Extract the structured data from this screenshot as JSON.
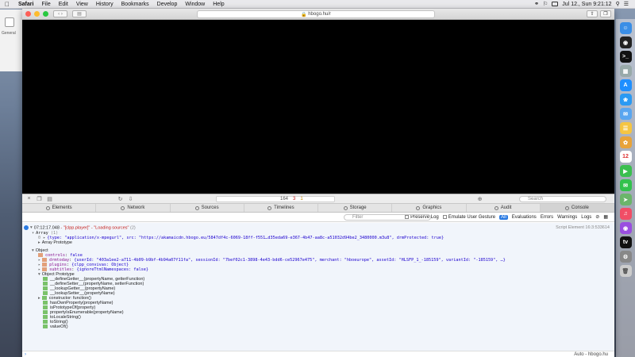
{
  "menubar": {
    "app": "Safari",
    "items": [
      "File",
      "Edit",
      "View",
      "History",
      "Bookmarks",
      "Develop",
      "Window",
      "Help"
    ],
    "clock": "Jul 12., Sun  9:21:12"
  },
  "bg_window": {
    "label": "General"
  },
  "browser": {
    "url": "hbogo.hu/r"
  },
  "inspector": {
    "activity": {
      "resources": "164",
      "errors": "3",
      "warnings": "1"
    },
    "search_placeholder": "Search",
    "tabs": [
      "Elements",
      "Network",
      "Sources",
      "Timelines",
      "Storage",
      "Graphics",
      "Audit",
      "Console"
    ],
    "console_toolbar": {
      "filter_placeholder": "Filter",
      "preserve_log": "Preserve Log",
      "emulate": "Emulate User Gesture",
      "all": "All",
      "evaluations": "Evaluations",
      "errors": "Errors",
      "warnings": "Warnings",
      "logs": "Logs"
    },
    "log": {
      "timestamp": "07:12:17.048",
      "prefix": "- \"[clpp.player]\" - \"Loading sources\"",
      "count": "(2)",
      "source": "Script Element 16:3:533614",
      "array_label": "Array",
      "array_count": "(1)",
      "array_item": "{type: \"application/x-mpegurl\", src: \"https://akamaicdn.hbogo.eu/5847df4c-6069-18ff-f551…d35eda69-e367-4b47-aa8c-a51032d94be2_3480000.m3u8\", drmProtected: true}",
      "array_proto": "Array Prototype",
      "object_label": "Object",
      "props": [
        {
          "name": "controls",
          "value": "false"
        },
        {
          "name": "drmtoday",
          "value": "{userId: \"403a1ee2-a711-4b09-b9bf-4b94a07f11fa\", sessionId: \"7bef02c1-3898-4e43-bdd6-ce52967e475\", merchant: \"hboeurope\", assetId: \"HLSFP_1_-185159\", variantId: \"-185159\", …}"
        },
        {
          "name": "plugins",
          "value": "{clpp_convivas: Object}"
        },
        {
          "name": "subtitles",
          "value": "{ignoreTtmlNamespaces: false}"
        }
      ],
      "object_proto": "Object Prototype",
      "methods": [
        "__defineGetter__(propertyName, getterFunction)",
        "__defineSetter__(propertyName, setterFunction)",
        "__lookupGetter__(propertyName)",
        "__lookupSetter__(propertyName)",
        "constructor: function()",
        "hasOwnProperty(propertyName)",
        "isPrototypeOf(property)",
        "propertyIsEnumerable(propertyName)",
        "toLocaleString()",
        "toString()",
        "valueOf()"
      ]
    },
    "context": "Auto - hbogo.hu"
  },
  "colors": {
    "close": "#fc5f57",
    "min": "#fdbc2e",
    "max": "#28c840",
    "accent": "#2a7ae2"
  },
  "dock_icons": [
    "finder-icon",
    "siri-icon",
    "terminal-icon",
    "launchpad-icon",
    "appstore-icon",
    "safari-icon",
    "mail-icon",
    "notes-icon",
    "photos-icon",
    "calendar-icon",
    "facetime-icon",
    "messages-icon",
    "maps-icon",
    "music-icon",
    "podcasts-icon",
    "tv-icon",
    "settings-icon",
    "trash-icon"
  ]
}
